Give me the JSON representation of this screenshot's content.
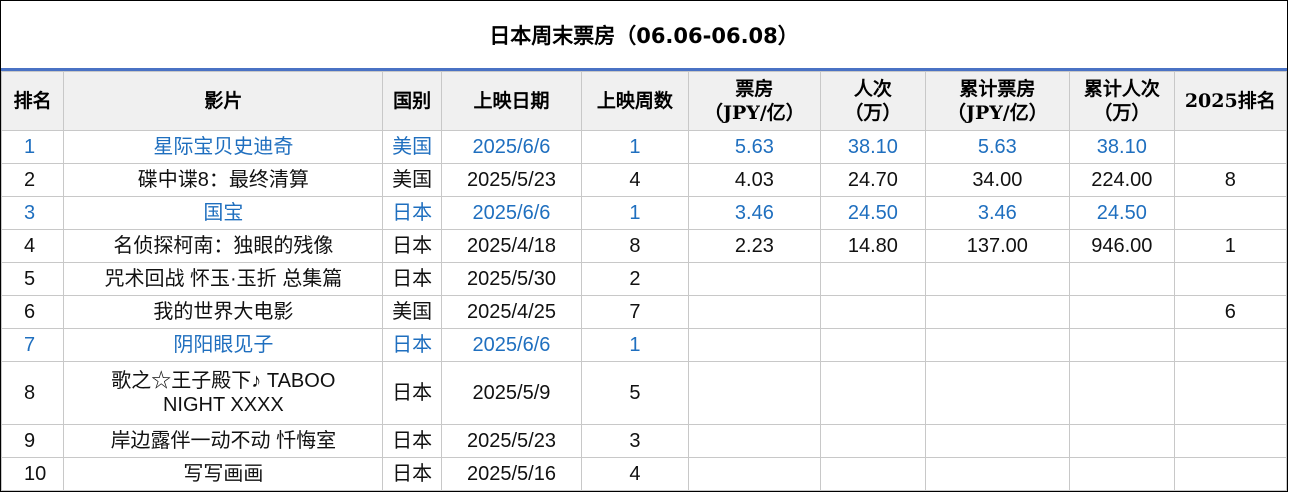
{
  "title": "日本周末票房（06.06-06.08）",
  "headers": [
    {
      "l1": "排名",
      "l2": ""
    },
    {
      "l1": "影片",
      "l2": ""
    },
    {
      "l1": "国别",
      "l2": ""
    },
    {
      "l1": "上映日期",
      "l2": ""
    },
    {
      "l1": "上映周数",
      "l2": ""
    },
    {
      "l1": "票房",
      "l2": "（JPY/亿）"
    },
    {
      "l1": "人次",
      "l2": "（万）"
    },
    {
      "l1": "累计票房",
      "l2": "（JPY/亿）"
    },
    {
      "l1": "累计人次",
      "l2": "（万）"
    },
    {
      "l1": "2025排名",
      "l2": ""
    }
  ],
  "rows": [
    {
      "rank": "1",
      "film": "星际宝贝史迪奇",
      "film2": "",
      "country": "美国",
      "date": "2025/6/6",
      "weeks": "1",
      "box": "5.63",
      "adm": "38.10",
      "cum_box": "5.63",
      "cum_adm": "38.10",
      "rank2025": "",
      "is_new": true
    },
    {
      "rank": "2",
      "film": "碟中谍8：最终清算",
      "film2": "",
      "country": "美国",
      "date": "2025/5/23",
      "weeks": "4",
      "box": "4.03",
      "adm": "24.70",
      "cum_box": "34.00",
      "cum_adm": "224.00",
      "rank2025": "8",
      "is_new": false
    },
    {
      "rank": "3",
      "film": "国宝",
      "film2": "",
      "country": "日本",
      "date": "2025/6/6",
      "weeks": "1",
      "box": "3.46",
      "adm": "24.50",
      "cum_box": "3.46",
      "cum_adm": "24.50",
      "rank2025": "",
      "is_new": true
    },
    {
      "rank": "4",
      "film": "名侦探柯南：独眼的残像",
      "film2": "",
      "country": "日本",
      "date": "2025/4/18",
      "weeks": "8",
      "box": "2.23",
      "adm": "14.80",
      "cum_box": "137.00",
      "cum_adm": "946.00",
      "rank2025": "1",
      "is_new": false
    },
    {
      "rank": "5",
      "film": "咒术回战 怀玉·玉折 总集篇",
      "film2": "",
      "country": "日本",
      "date": "2025/5/30",
      "weeks": "2",
      "box": "",
      "adm": "",
      "cum_box": "",
      "cum_adm": "",
      "rank2025": "",
      "is_new": false
    },
    {
      "rank": "6",
      "film": "我的世界大电影",
      "film2": "",
      "country": "美国",
      "date": "2025/4/25",
      "weeks": "7",
      "box": "",
      "adm": "",
      "cum_box": "",
      "cum_adm": "",
      "rank2025": "6",
      "is_new": false
    },
    {
      "rank": "7",
      "film": "阴阳眼见子",
      "film2": "",
      "country": "日本",
      "date": "2025/6/6",
      "weeks": "1",
      "box": "",
      "adm": "",
      "cum_box": "",
      "cum_adm": "",
      "rank2025": "",
      "is_new": true
    },
    {
      "rank": "8",
      "film": "歌之☆王子殿下♪ TABOO",
      "film2": "NIGHT XXXX",
      "country": "日本",
      "date": "2025/5/9",
      "weeks": "5",
      "box": "",
      "adm": "",
      "cum_box": "",
      "cum_adm": "",
      "rank2025": "",
      "is_new": false
    },
    {
      "rank": "9",
      "film": "岸边露伴一动不动 忏悔室",
      "film2": "",
      "country": "日本",
      "date": "2025/5/23",
      "weeks": "3",
      "box": "",
      "adm": "",
      "cum_box": "",
      "cum_adm": "",
      "rank2025": "",
      "is_new": false
    },
    {
      "rank": "10",
      "film": "写写画画",
      "film2": "",
      "country": "日本",
      "date": "2025/5/16",
      "weeks": "4",
      "box": "",
      "adm": "",
      "cum_box": "",
      "cum_adm": "",
      "rank2025": "",
      "is_new": false
    }
  ],
  "colors": {
    "new_release_text": "#1f6fbf",
    "title_rule": "#4a72c4",
    "header_bg": "#f0f0f0"
  }
}
